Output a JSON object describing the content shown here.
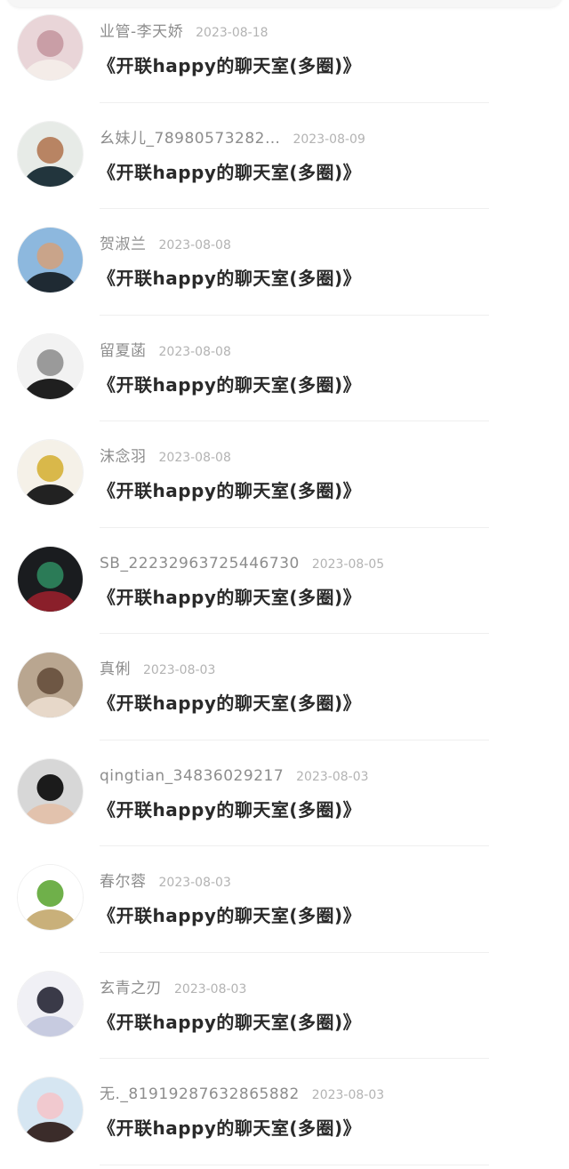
{
  "comments": [
    {
      "name": "业管-李天娇",
      "date": "2023-08-18",
      "text": "《开联happy的聊天室(多圈)》",
      "colors": [
        "#e9d5d8",
        "#c99ea6",
        "#f4ece8"
      ]
    },
    {
      "name": "幺妹儿_78980573282…",
      "date": "2023-08-09",
      "text": "《开联happy的聊天室(多圈)》",
      "colors": [
        "#e7ebe7",
        "#b88463",
        "#22353d"
      ]
    },
    {
      "name": "贺淑兰",
      "date": "2023-08-08",
      "text": "《开联happy的聊天室(多圈)》",
      "colors": [
        "#8db8de",
        "#c9a48a",
        "#1f2a33"
      ]
    },
    {
      "name": "留夏菡",
      "date": "2023-08-08",
      "text": "《开联happy的聊天室(多圈)》",
      "colors": [
        "#f2f2f2",
        "#9a9a9a",
        "#1f1f1f"
      ]
    },
    {
      "name": "沫念羽",
      "date": "2023-08-08",
      "text": "《开联happy的聊天室(多圈)》",
      "colors": [
        "#f5f1e8",
        "#d9b84a",
        "#222222"
      ]
    },
    {
      "name": "SB_22232963725446730",
      "date": "2023-08-05",
      "text": "《开联happy的聊天室(多圈)》",
      "colors": [
        "#1a1c1f",
        "#2b7b57",
        "#8a1f2a"
      ]
    },
    {
      "name": "真俐",
      "date": "2023-08-03",
      "text": "《开联happy的聊天室(多圈)》",
      "colors": [
        "#b9a690",
        "#6e5744",
        "#e7d8c9"
      ]
    },
    {
      "name": "qingtian_34836029217",
      "date": "2023-08-03",
      "text": "《开联happy的聊天室(多圈)》",
      "colors": [
        "#d7d7d7",
        "#1b1b1b",
        "#e2c2ad"
      ]
    },
    {
      "name": "春尔蓉",
      "date": "2023-08-03",
      "text": "《开联happy的聊天室(多圈)》",
      "colors": [
        "#ffffff",
        "#6fb04a",
        "#c9b07a"
      ]
    },
    {
      "name": "玄青之刃",
      "date": "2023-08-03",
      "text": "《开联happy的聊天室(多圈)》",
      "colors": [
        "#f0f0f5",
        "#3a3a48",
        "#c7cbe0"
      ]
    },
    {
      "name": "无._81919287632865882",
      "date": "2023-08-03",
      "text": "《开联happy的聊天室(多圈)》",
      "colors": [
        "#d6e6f2",
        "#f1c9cf",
        "#3b2c2a"
      ]
    }
  ]
}
